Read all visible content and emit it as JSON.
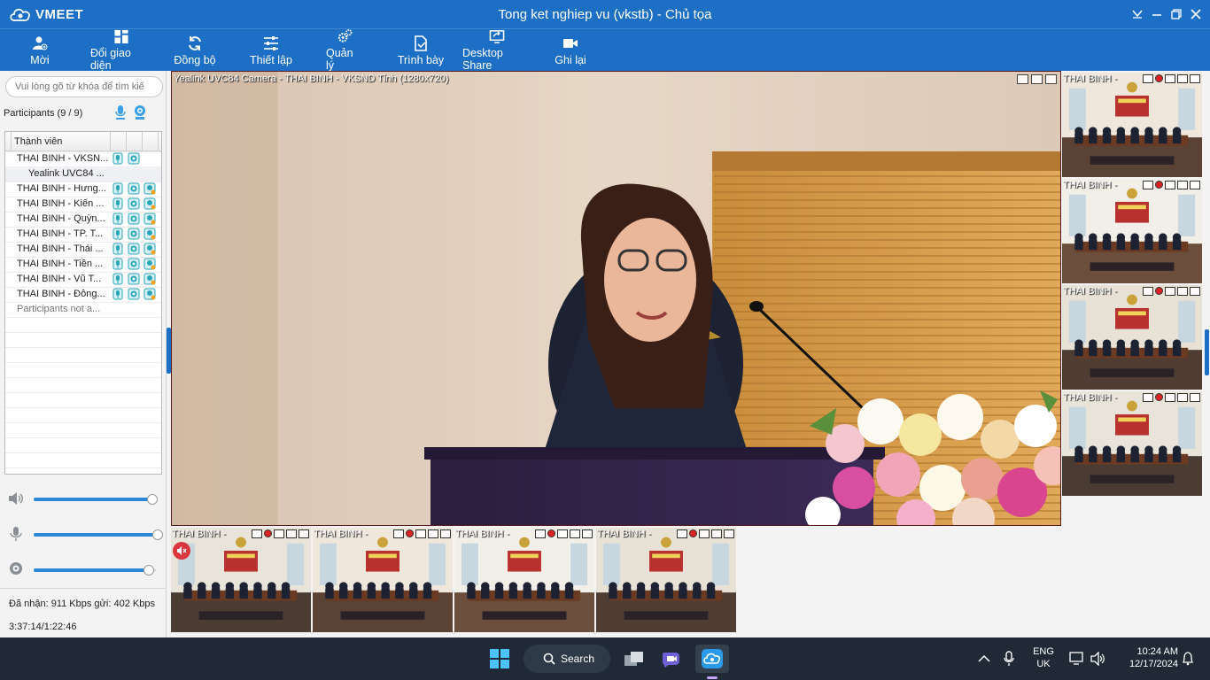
{
  "app": {
    "logo_text": "VMEET",
    "window_title": "Tong ket nghiep vu (vkstb) - Chủ tọa"
  },
  "toolbar": {
    "items": [
      {
        "label": "Mời",
        "icon": "invite-user-icon"
      },
      {
        "label": "Đổi giao diện",
        "icon": "layout-grid-icon"
      },
      {
        "label": "Đồng bộ",
        "icon": "sync-icon"
      },
      {
        "label": "Thiết lập",
        "icon": "settings-sliders-icon"
      },
      {
        "label": "Quản lý",
        "icon": "gears-icon"
      },
      {
        "label": "Trình bày",
        "icon": "present-document-icon"
      },
      {
        "label": "Desktop Share",
        "icon": "screen-share-icon"
      },
      {
        "label": "Ghi lại",
        "icon": "record-camera-icon"
      }
    ]
  },
  "left": {
    "search_placeholder": "Vui lòng gõ từ khóa để tìm kiế",
    "participants_label": "Participants (9 / 9)",
    "column_header": "Thành viên",
    "participants": [
      {
        "name": "THAI BINH - VKSN...",
        "mic": true,
        "cam": true,
        "share": false
      },
      {
        "name": "Yealink UVC84 ...",
        "sub": true
      },
      {
        "name": "THAI BINH - Hưng...",
        "mic": true,
        "cam": true,
        "share": true
      },
      {
        "name": "THAI BINH - Kiến ...",
        "mic": true,
        "cam": true,
        "share": true
      },
      {
        "name": "THAI BINH - Quỳn...",
        "mic": true,
        "cam": true,
        "share": true
      },
      {
        "name": "THAI BINH - TP. T...",
        "mic": true,
        "cam": true,
        "share": true
      },
      {
        "name": "THAI BINH - Thái ...",
        "mic": true,
        "cam": true,
        "share": true
      },
      {
        "name": "THAI BINH - Tiền ...",
        "mic": true,
        "cam": true,
        "share": true
      },
      {
        "name": "THAI BINH - Vũ T...",
        "mic": true,
        "cam": true,
        "share": true
      },
      {
        "name": "THAI BINH - Đông...",
        "mic": true,
        "cam": true,
        "share": true
      },
      {
        "name": "Participants not a...",
        "grey": true
      }
    ],
    "speaker_volume": 0.97,
    "mic_volume": 0.99,
    "camera_level": 0.94,
    "bandwidth": "Đã nhận: 911 Kbps gửi: 402 Kbps",
    "elapsed": "3:37:14/1:22:46"
  },
  "main_video": {
    "caption": "Yealink UVC84 Camera - THAI BINH - VKSND Tỉnh (1280x720)"
  },
  "bottom_thumbs": [
    {
      "label": "THAI BINH - VKSND",
      "muted": true
    },
    {
      "label": "THAI BINH - V"
    },
    {
      "label": "THAI BINH - T"
    },
    {
      "label": "THAI BINH - K"
    }
  ],
  "right_thumbs": [
    {
      "label": "THAI BINH - Q"
    },
    {
      "label": "THAI BINH - Đ"
    },
    {
      "label": "THAI BINH - T"
    },
    {
      "label": "THAI BINH - T"
    }
  ],
  "taskbar": {
    "search_label": "Search",
    "lang_top": "ENG",
    "lang_bottom": "UK",
    "clock_time": "10:24 AM",
    "clock_date": "12/17/2024"
  }
}
